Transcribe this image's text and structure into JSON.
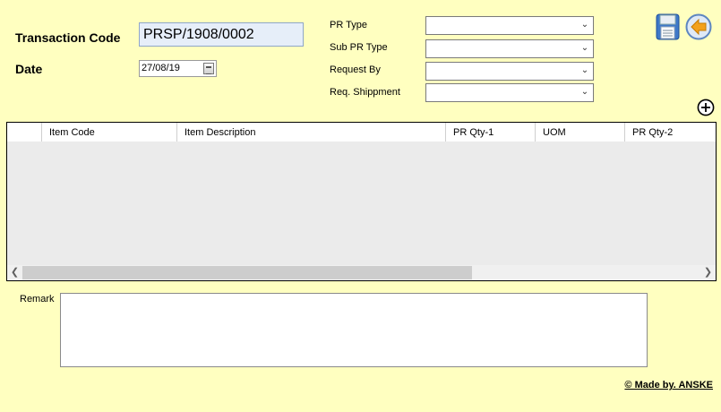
{
  "header": {
    "transaction_code_label": "Transaction Code",
    "transaction_code_value": "PRSP/1908/0002",
    "date_label": "Date",
    "date_value": "27/08/19"
  },
  "filters": {
    "pr_type_label": "PR Type",
    "sub_pr_type_label": "Sub PR Type",
    "request_by_label": "Request By",
    "req_shipment_label": "Req. Shippment",
    "pr_type_value": "",
    "sub_pr_type_value": "",
    "request_by_value": "",
    "req_shipment_value": ""
  },
  "toolbar": {
    "save_icon": "floppy-disk-icon",
    "back_icon": "back-arrow-icon",
    "add_icon": "add-circle-icon"
  },
  "grid": {
    "columns": [
      "",
      "Item Code",
      "Item Description",
      "PR Qty-1",
      "UOM",
      "PR Qty-2"
    ],
    "rows": []
  },
  "remark": {
    "label": "Remark",
    "value": ""
  },
  "footer": {
    "credit": "© Made by. ANSKE"
  },
  "colors": {
    "background": "#ffffc0",
    "grid_empty": "#ababab",
    "txn_box": "#e6eef9",
    "back_icon": "#f0a020"
  }
}
